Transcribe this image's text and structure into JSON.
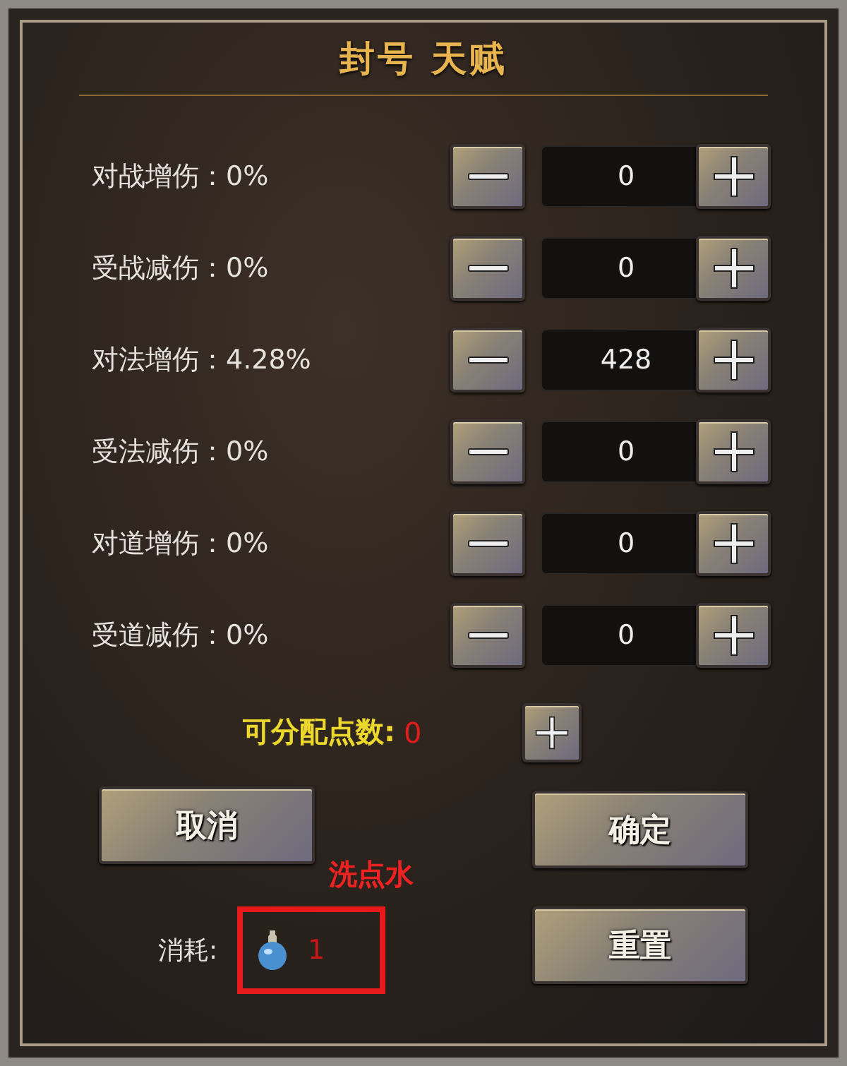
{
  "title": "封号 天赋",
  "stats": [
    {
      "label": "对战增伤：0%",
      "value": "0"
    },
    {
      "label": "受战减伤：0%",
      "value": "0"
    },
    {
      "label": "对法增伤：4.28%",
      "value": "428"
    },
    {
      "label": "受法减伤：0%",
      "value": "0"
    },
    {
      "label": "对道增伤：0%",
      "value": "0"
    },
    {
      "label": "受道减伤：0%",
      "value": "0"
    }
  ],
  "points": {
    "label": "可分配点数:",
    "value": "0"
  },
  "buttons": {
    "cancel": "取消",
    "confirm": "确定",
    "reset": "重置"
  },
  "annotation": "洗点水",
  "cost": {
    "label": "消耗:",
    "value": "1"
  }
}
